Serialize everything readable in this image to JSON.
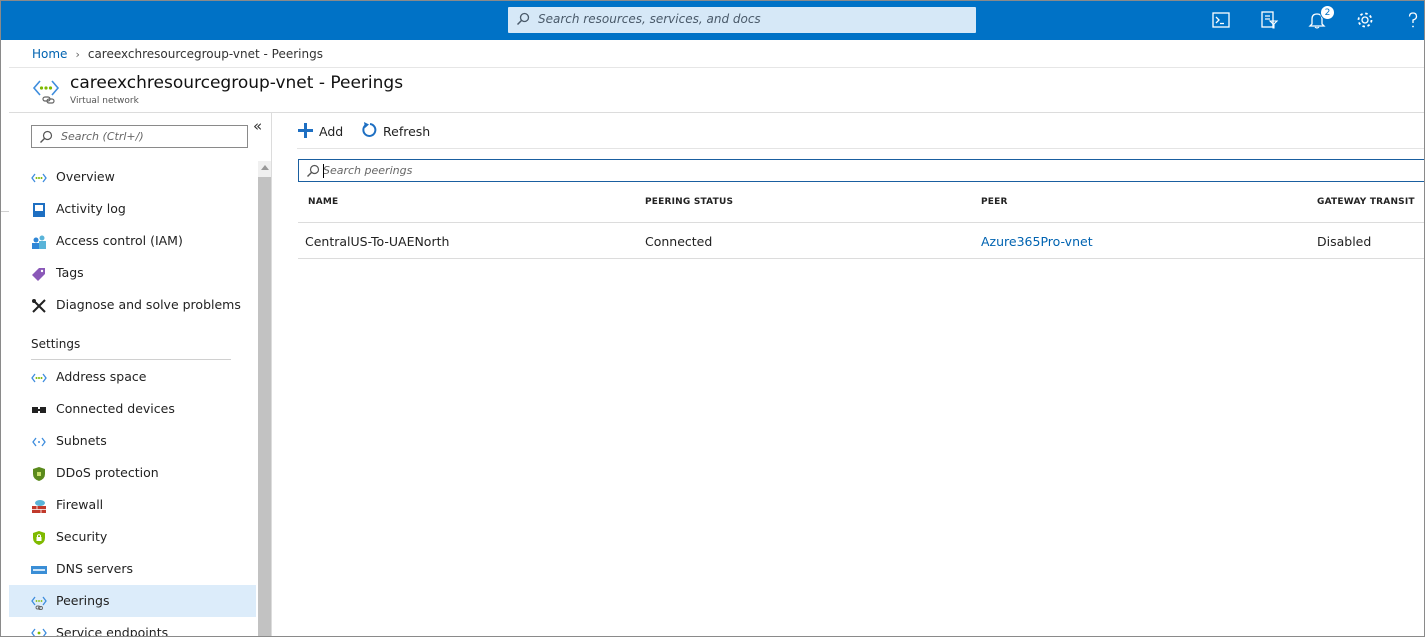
{
  "topbar": {
    "search_placeholder": "Search resources, services, and docs",
    "notification_count": "2",
    "icons": [
      "cloud-shell-icon",
      "directory-filter-icon",
      "bell-icon",
      "gear-icon",
      "help-icon"
    ]
  },
  "breadcrumb": {
    "home": "Home",
    "current": "careexchresourcegroup-vnet - Peerings"
  },
  "header": {
    "title": "careexchresourcegroup-vnet - Peerings",
    "subtitle": "Virtual network"
  },
  "sidebar": {
    "search_placeholder": "Search (Ctrl+/)",
    "collapse_label": "«",
    "items": [
      {
        "label": "Overview",
        "icon": "vnet-icon"
      },
      {
        "label": "Activity log",
        "icon": "activity-log-icon"
      },
      {
        "label": "Access control (IAM)",
        "icon": "iam-icon"
      },
      {
        "label": "Tags",
        "icon": "tag-icon"
      },
      {
        "label": "Diagnose and solve problems",
        "icon": "wrench-icon"
      }
    ],
    "settings_title": "Settings",
    "settings_items": [
      {
        "label": "Address space",
        "icon": "vnet-icon"
      },
      {
        "label": "Connected devices",
        "icon": "connected-devices-icon"
      },
      {
        "label": "Subnets",
        "icon": "subnet-icon"
      },
      {
        "label": "DDoS protection",
        "icon": "shield-icon"
      },
      {
        "label": "Firewall",
        "icon": "firewall-icon"
      },
      {
        "label": "Security",
        "icon": "security-icon"
      },
      {
        "label": "DNS servers",
        "icon": "dns-icon"
      },
      {
        "label": "Peerings",
        "icon": "peering-icon",
        "active": true
      },
      {
        "label": "Service endpoints",
        "icon": "service-endpoint-icon"
      }
    ]
  },
  "toolbar": {
    "add_label": "Add",
    "refresh_label": "Refresh"
  },
  "peerings": {
    "search_placeholder": "Search peerings",
    "columns": [
      "NAME",
      "PEERING STATUS",
      "PEER",
      "GATEWAY TRANSIT"
    ],
    "rows": [
      {
        "name": "CentralUS-To-UAENorth",
        "status": "Connected",
        "peer": "Azure365Pro-vnet",
        "gateway_transit": "Disabled"
      }
    ]
  },
  "colors": {
    "topbar": "#0072c6",
    "link": "#0063b1",
    "active_item": "#dcecfa"
  }
}
